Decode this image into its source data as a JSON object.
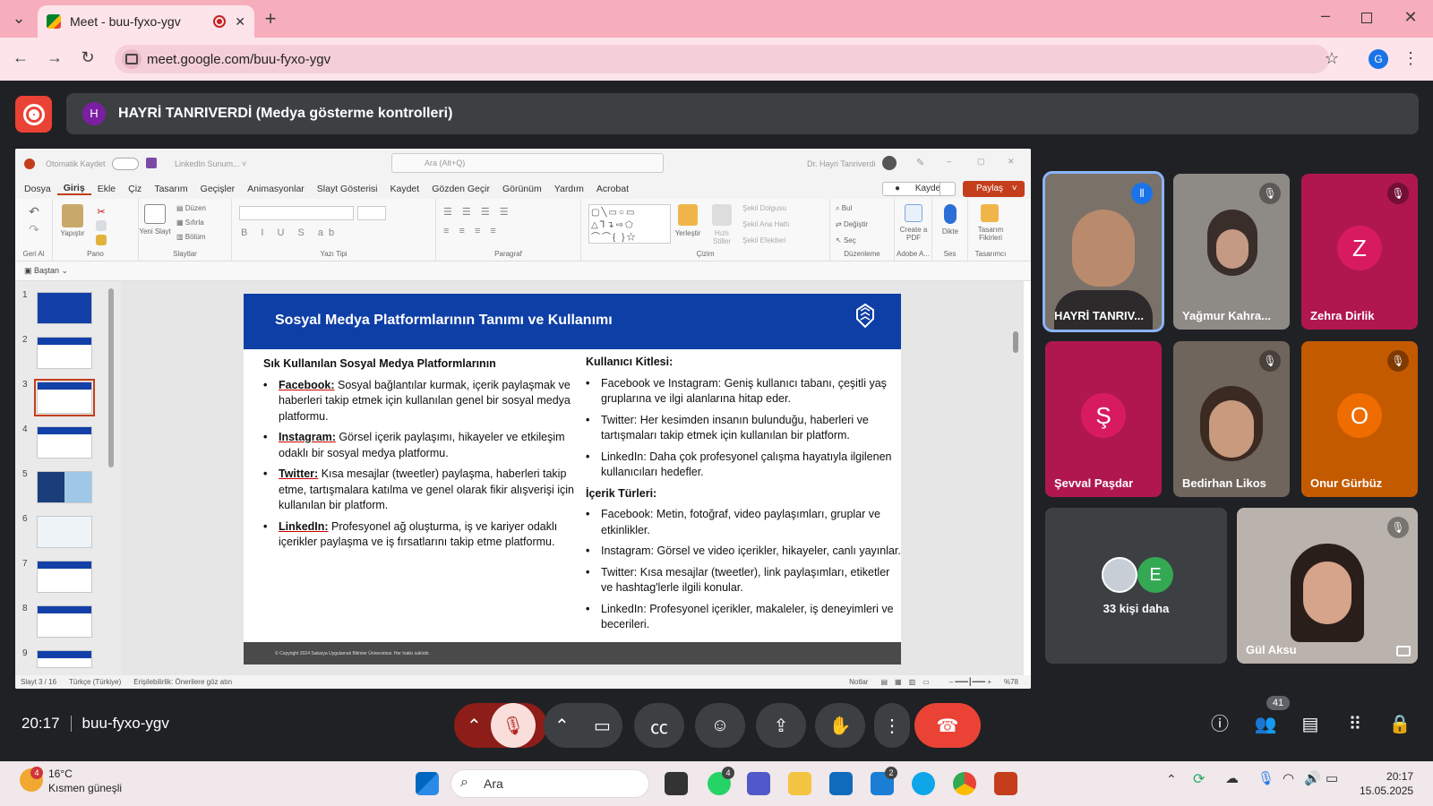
{
  "browser": {
    "tab_title": "Meet - buu-fyxo-ygv",
    "url": "meet.google.com/buu-fyxo-ygv",
    "profile_initial": "G"
  },
  "banner": {
    "initial": "H",
    "text": "HAYRİ TANRIVERDİ (Medya gösterme kontrolleri)"
  },
  "powerpoint": {
    "autosave_label": "Otomatik Kaydet",
    "doc_name": "LinkedIn Sunum... ˅",
    "search_placeholder": "Ara (Alt+Q)",
    "user_name": "Dr. Hayri Tanriverdi",
    "menu": [
      "Dosya",
      "Giriş",
      "Ekle",
      "Çiz",
      "Tasarım",
      "Geçişler",
      "Animasyonlar",
      "Slayt Gösterisi",
      "Kaydet",
      "Gözden Geçir",
      "Görünüm",
      "Yardım",
      "Acrobat"
    ],
    "record_button": "Kaydet",
    "share_button": "Paylaş",
    "ribbon_groups": [
      "Geri Al",
      "Pano",
      "Slaytlar",
      "Yazı Tipi",
      "Paragraf",
      "Çizim",
      "Düzenleme",
      "Adobe A...",
      "Ses",
      "Tasarımcı"
    ],
    "ribbon_labels": {
      "paste": "Yapıştır",
      "new_slide": "Yeni Slayt",
      "layout": "Düzen",
      "reset": "Sıfırla",
      "section": "Bölüm",
      "arrange": "Yerleştir",
      "quick_styles": "Hızlı Stiller",
      "shape_fill": "Şekil Dolgusu",
      "shape_outline": "Şekil Ana Hattı",
      "shape_effects": "Şekil Efektleri",
      "find": "Bul",
      "replace": "Değiştir",
      "select": "Seç",
      "create_pdf": "Create a PDF",
      "dictate": "Dikte",
      "designer": "Tasarım Fikirleri"
    },
    "from_start": "Baştan",
    "slide_numbers": [
      "1",
      "2",
      "3",
      "4",
      "5",
      "6",
      "7",
      "8",
      "9"
    ],
    "status_left": "Slayt 3 / 16",
    "status_lang": "Türkçe (Türkiye)",
    "status_access": "Erişilebilirlik: Önerilere göz atın",
    "status_notes": "Notlar",
    "zoom": "%78"
  },
  "slide": {
    "title": "Sosyal Medya Platformlarının Tanımı ve Kullanımı",
    "left_heading": "Sık Kullanılan Sosyal Medya Platformlarının",
    "left_items": [
      {
        "name": "Facebook:",
        "text": " Sosyal bağlantılar kurmak, içerik paylaşmak ve haberleri takip etmek için kullanılan genel bir sosyal medya platformu."
      },
      {
        "name": "Instagram:",
        "text": " Görsel içerik paylaşımı, hikayeler ve etkileşim odaklı bir sosyal medya platformu."
      },
      {
        "name": "Twitter:",
        "text": " Kısa mesajlar (tweetler) paylaşma, haberleri takip etme, tartışmalara katılma ve genel olarak fikir alışverişi için kullanılan bir platform."
      },
      {
        "name": "LinkedIn:",
        "text": " Profesyonel ağ oluşturma, iş ve kariyer odaklı içerikler paylaşma ve iş fırsatlarını takip etme platformu."
      }
    ],
    "audience_heading": "Kullanıcı Kitlesi:",
    "audience_items": [
      "Facebook ve Instagram: Geniş kullanıcı tabanı, çeşitli yaş gruplarına ve ilgi alanlarına hitap eder.",
      "Twitter: Her kesimden insanın bulunduğu, haberleri ve tartışmaları takip etmek için kullanılan bir platform.",
      "LinkedIn: Daha çok profesyonel çalışma hayatıyla ilgilenen kullanıcıları hedefler."
    ],
    "content_heading": "İçerik Türleri:",
    "content_items": [
      "Facebook: Metin, fotoğraf, video paylaşımları, gruplar ve etkinlikler.",
      "Instagram: Görsel ve video içerikler, hikayeler, canlı yayınlar.",
      "Twitter: Kısa mesajlar (tweetler), link paylaşımları, etiketler ve hashtag'lerle ilgili konular.",
      "LinkedIn: Profesyonel içerikler, makaleler, iş deneyimleri ve becerileri."
    ],
    "footer": "© Copyright 2024 Sakarya Uygulamalı Bilimler Üniversitesi. Her hakkı saklıdır."
  },
  "participants": [
    {
      "name": "HAYRİ TANRIV...",
      "type": "video",
      "bg": "#7a7268",
      "speaking": true
    },
    {
      "name": "Yağmur Kahra...",
      "type": "video",
      "bg": "#8e8a86",
      "muted": true
    },
    {
      "name": "Zehra Dirlik",
      "type": "avatar",
      "initial": "Z",
      "bg": "#b0174f",
      "avatar_bg": "#d81b60",
      "muted": true
    },
    {
      "name": "Şevval Paşdar",
      "type": "avatar",
      "initial": "Ş",
      "bg": "#b0174f",
      "avatar_bg": "#d81b60"
    },
    {
      "name": "Bedirhan Likos",
      "type": "video",
      "bg": "#6f655c",
      "muted": true
    },
    {
      "name": "Onur Gürbüz",
      "type": "avatar",
      "initial": "O",
      "bg": "#c45a00",
      "avatar_bg": "#ef6c00",
      "muted": true
    },
    {
      "name": "Gül Aksu",
      "type": "video",
      "bg": "#b9b2ad",
      "muted": true
    }
  ],
  "others": {
    "label": "33 kişi daha",
    "initial": "E"
  },
  "meeting": {
    "time": "20:17",
    "code": "buu-fyxo-ygv",
    "people_count": "41"
  },
  "taskbar": {
    "weather_badge": "4",
    "temp": "16°C",
    "condition": "Kısmen güneşli",
    "search": "Ara",
    "whatsapp_badge": "4",
    "store_badge": "2",
    "clock_time": "20:17",
    "clock_date": "15.05.2025"
  },
  "colors": {
    "tabbar": "#f7aebc",
    "meet_bg": "#202124",
    "slide_blue": "#0e3fa6",
    "end_call": "#ea4335",
    "powerpoint_accent": "#c43e1c"
  }
}
